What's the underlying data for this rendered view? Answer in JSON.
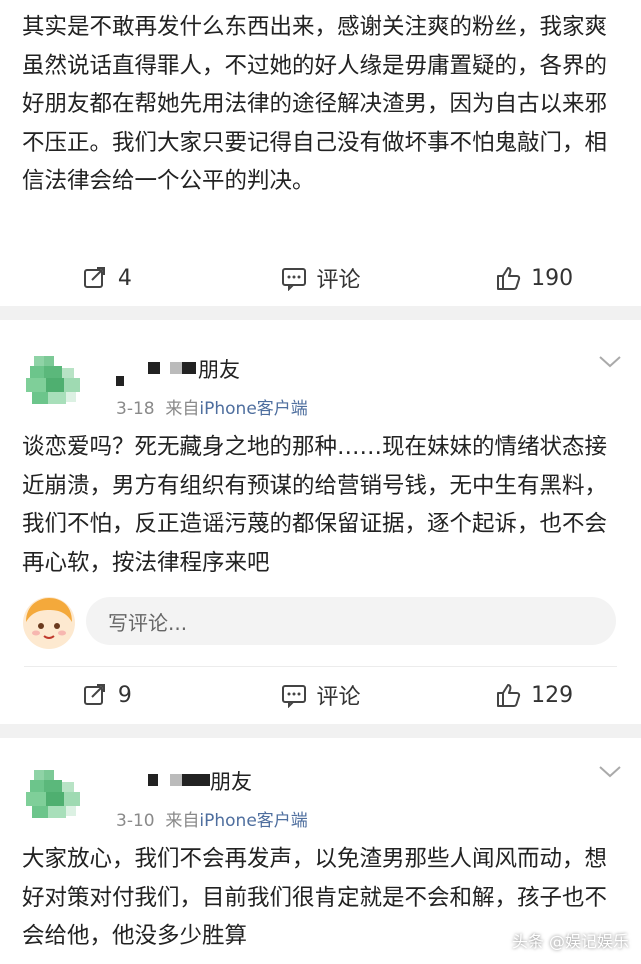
{
  "post1": {
    "text": "其实是不敢再发什么东西出来，感谢关注爽的粉丝，我家爽虽然说话直得罪人，不过她的好人缘是毋庸置疑的，各界的好朋友都在帮她先用法律的途径解决渣男，因为自古以来邪不压正。我们大家只要记得自己没有做坏事不怕鬼敲门，相信法律会给一个公平的判决。",
    "repost_count": "4",
    "comment_label": "评论",
    "like_count": "190"
  },
  "post2": {
    "username": "朋友",
    "date": "3-18",
    "source_prefix": "来自",
    "source": "iPhone客户端",
    "text": "谈恋爱吗？死无藏身之地的那种……现在妹妹的情绪状态接近崩溃，男方有组织有预谋的给营销号钱，无中生有黑料，我们不怕，反正造谣污蔑的都保留证据，逐个起诉，也不会再心软，按法律程序来吧",
    "comment_placeholder": "写评论...",
    "repost_count": "9",
    "comment_label": "评论",
    "like_count": "129"
  },
  "post3": {
    "username": "朋友",
    "date": "3-10",
    "source_prefix": "来自",
    "source": "iPhone客户端",
    "text": "大家放心，我们不会再发声，以免渣男那些人闻风而动，想好对策对付我们，目前我们很肯定就是不会和解，孩子也不会给他，他没多少胜算"
  },
  "watermark": "头条 @娱记娱乐",
  "colors": {
    "link": "#4e6e9e",
    "separator": "#f1f1f1",
    "avatar_green": "#6cc58b"
  }
}
